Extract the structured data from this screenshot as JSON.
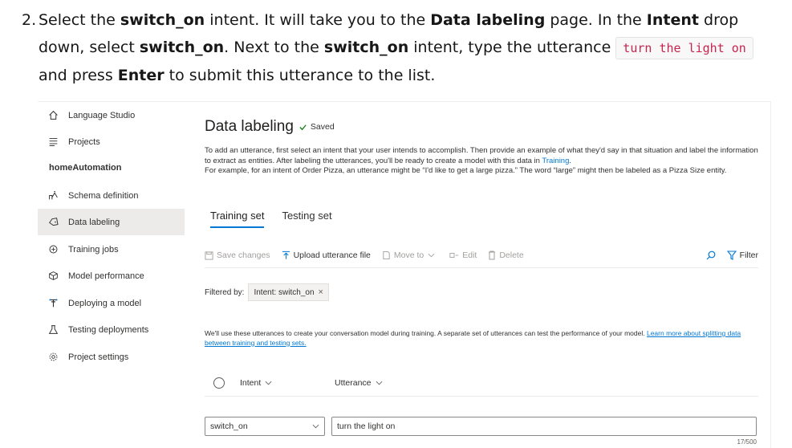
{
  "instruction": {
    "number": "2.",
    "t1": "Select the ",
    "b1": "switch_on",
    "t2": " intent. It will take you to the ",
    "b2": "Data labeling",
    "t3": " page. In the ",
    "b3": "Intent",
    "t4": " drop down, select ",
    "b4": "switch_on",
    "t5": ". Next to the ",
    "b5": "switch_on",
    "t6": " intent, type the utterance ",
    "code": "turn the light on",
    "t7": " and press ",
    "b6": "Enter",
    "t8": " to submit this utterance to the list."
  },
  "sidebar": {
    "project": "homeAutomation",
    "items": [
      {
        "label": "Language Studio",
        "icon": "home-icon"
      },
      {
        "label": "Projects",
        "icon": "list-icon"
      },
      {
        "label": "Schema definition",
        "icon": "schema-icon"
      },
      {
        "label": "Data labeling",
        "icon": "tag-icon"
      },
      {
        "label": "Training jobs",
        "icon": "training-icon"
      },
      {
        "label": "Model performance",
        "icon": "cube-icon"
      },
      {
        "label": "Deploying a model",
        "icon": "deploy-icon"
      },
      {
        "label": "Testing deployments",
        "icon": "flask-icon"
      },
      {
        "label": "Project settings",
        "icon": "gear-icon"
      }
    ],
    "active": "Data labeling"
  },
  "page": {
    "title": "Data labeling",
    "saved": "Saved",
    "desc1_a": "To add an utterance, first select an intent that your user intends to accomplish. Then provide an example of what they'd say in that situation and label the information to extract as entities. After labeling the utterances, you'll be ready to create a model with this data in ",
    "desc1_link": "Training",
    "desc1_b": ".",
    "desc2": "For example, for an intent of Order Pizza, an utterance might be “I'd like to get a large pizza.” The word “large” might then be labeled as a Pizza Size entity.",
    "tabs": [
      "Training set",
      "Testing set"
    ],
    "active_tab": "Training set"
  },
  "toolbar": {
    "save": "Save changes",
    "upload": "Upload utterance file",
    "move": "Move to",
    "edit": "Edit",
    "delete": "Delete",
    "filter": "Filter"
  },
  "filter": {
    "label": "Filtered by:",
    "chip": "Intent: switch_on",
    "remove": "×"
  },
  "note": {
    "text": "We'll use these utterances to create your conversation model during training. A separate set of utterances can test the performance of your model. ",
    "link": "Learn more about splitting data between training and testing sets."
  },
  "table": {
    "col_intent": "Intent",
    "col_utterance": "Utterance"
  },
  "entry": {
    "intent_value": "switch_on",
    "utterance_value": "turn the light on",
    "char_count": "17/500"
  },
  "colors": {
    "accent": "#0078d4",
    "code_text": "#c7254e",
    "active_bg": "#edebe9"
  }
}
